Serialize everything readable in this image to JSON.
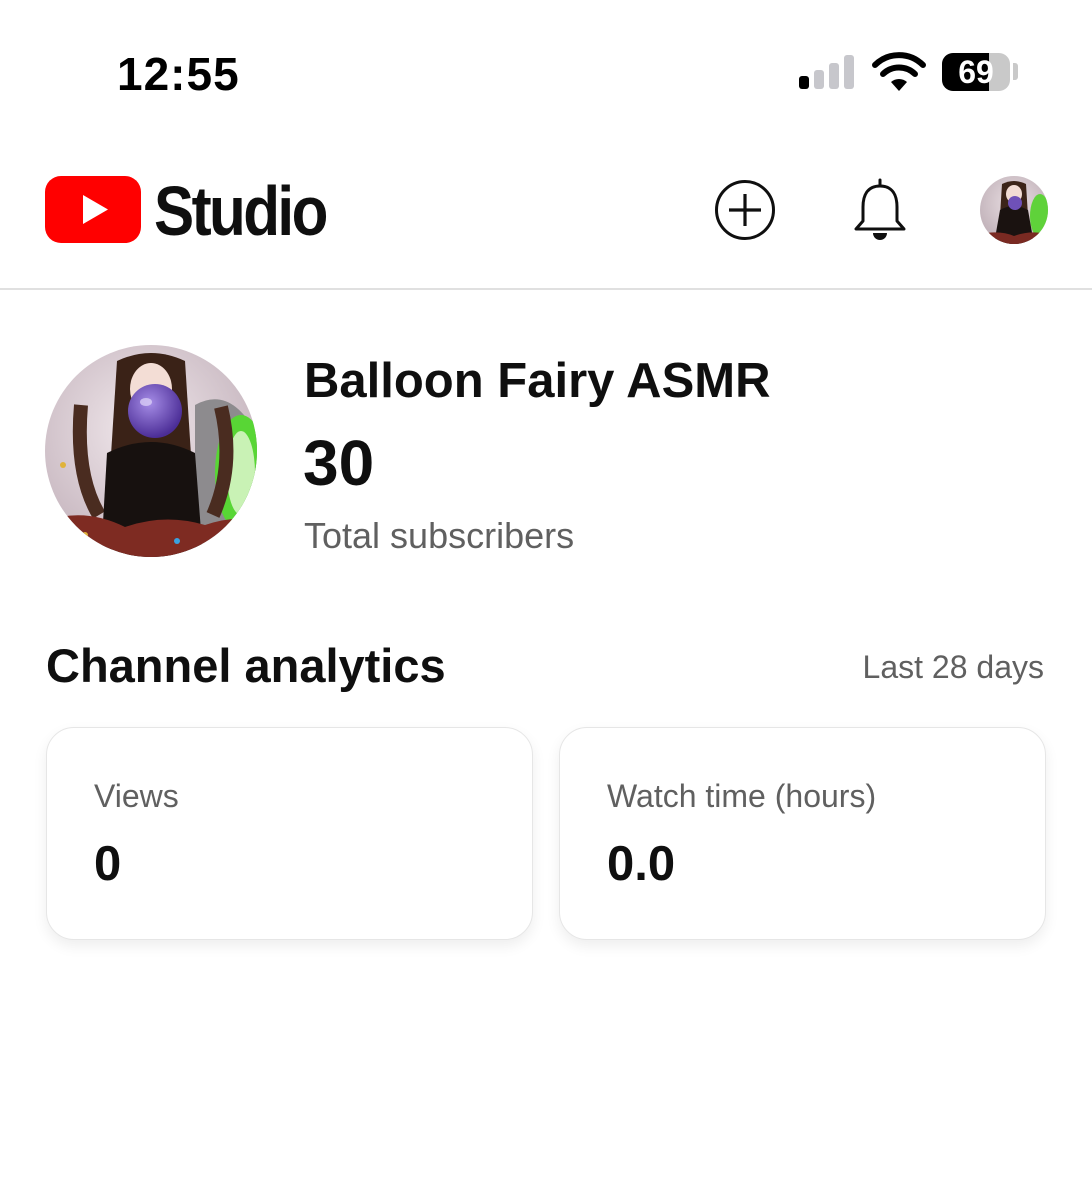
{
  "status_bar": {
    "time": "12:55",
    "battery_level": "69",
    "signal_bars_active": 1,
    "signal_bars_total": 4
  },
  "header": {
    "logo": "youtube-play-logo",
    "title": "Studio",
    "icons": {
      "create": "create-plus-icon",
      "notifications": "bell-icon",
      "account": "account-avatar"
    }
  },
  "channel": {
    "name": "Balloon Fairy ASMR",
    "subscriber_count": "30",
    "subscriber_label": "Total subscribers"
  },
  "analytics": {
    "title": "Channel analytics",
    "period": "Last 28 days",
    "metrics": [
      {
        "label": "Views",
        "value": "0"
      },
      {
        "label": "Watch time (hours)",
        "value": "0.0"
      }
    ]
  },
  "colors": {
    "brand_red": "#ff0000",
    "text_primary": "#0f0f0f",
    "text_secondary": "#606060",
    "divider": "#e0e0e0"
  }
}
